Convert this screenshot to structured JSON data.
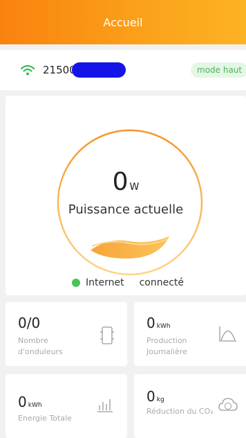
{
  "header": {
    "title": "Accueil"
  },
  "device": {
    "id_visible": "21500",
    "mode": "mode haut"
  },
  "power": {
    "value": "0",
    "unit": "W",
    "label": "Puissance actuelle"
  },
  "internet": {
    "label": "Internet",
    "status": "connecté"
  },
  "stats": {
    "inverters": {
      "value": "0/0",
      "label": "Nombre d'onduleurs",
      "icon": "inverter-icon"
    },
    "daily": {
      "value": "0",
      "unit": "kWh",
      "label": "Production Journalière",
      "icon": "curve-chart-icon"
    },
    "total": {
      "value": "0",
      "unit": "kWh",
      "label": "Energie Totale",
      "icon": "bar-chart-icon"
    },
    "co2": {
      "value": "0",
      "unit": "kg",
      "label": "Réduction du CO₂",
      "icon": "co2-cloud-icon"
    }
  },
  "colors": {
    "accent": "#fa9316",
    "status_green": "#4cc35a",
    "redaction": "#1414e8"
  }
}
